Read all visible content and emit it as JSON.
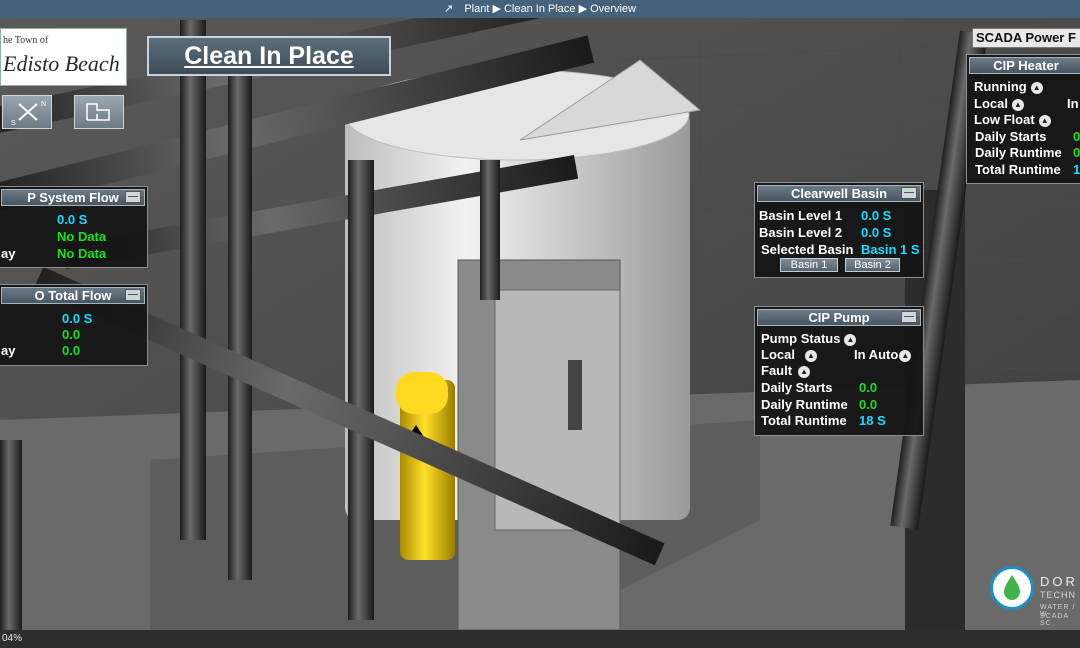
{
  "breadcrumb": "Plant ▶ Clean In Place ▶ Overview",
  "logo": {
    "line1": "he Town of",
    "line2": "Edisto Beach"
  },
  "title": "Clean In Place",
  "scada_label": "SCADA Power F",
  "cip_heater": {
    "title": "CIP Heater",
    "running": "Running",
    "local": "Local",
    "in_label": "In",
    "low_float": "Low Float",
    "daily_starts_label": "Daily Starts",
    "daily_starts_value": "0",
    "daily_runtime_label": "Daily Runtime",
    "daily_runtime_value": "0",
    "total_runtime_label": "Total Runtime",
    "total_runtime_value": "1"
  },
  "cip_system_flow": {
    "title": "P System Flow",
    "value1": "0.0 S",
    "value2": "No Data",
    "label3": "ay",
    "value3": "No Data"
  },
  "cip_total_flow": {
    "title": "O Total Flow",
    "value1": "0.0 S",
    "value2": "0.0",
    "label3": "ay",
    "value3": "0.0"
  },
  "clearwell": {
    "title": "Clearwell Basin",
    "level1_label": "Basin Level 1",
    "level1_value": "0.0 S",
    "level2_label": "Basin Level 2",
    "level2_value": "0.0 S",
    "selected_label": "Selected Basin",
    "selected_value": "Basin 1 S",
    "btn1": "Basin 1",
    "btn2": "Basin 2"
  },
  "cip_pump": {
    "title": "CIP Pump",
    "status_label": "Pump Status",
    "local_label": "Local",
    "auto_label": "In Auto",
    "fault_label": "Fault",
    "daily_starts_label": "Daily Starts",
    "daily_starts_value": "0.0",
    "daily_runtime_label": "Daily Runtime",
    "daily_runtime_value": "0.0",
    "total_runtime_label": "Total Runtime",
    "total_runtime_value": "18 S"
  },
  "dorsett": {
    "name": "DOR",
    "sub": "TECHN",
    "sub2": "WATER / W",
    "sub3": "SCADA SC"
  },
  "zoom": "04%",
  "colors": {
    "value_cyan": "#18dcff",
    "value_green": "#19e01f",
    "header_blue": "#44627c"
  }
}
